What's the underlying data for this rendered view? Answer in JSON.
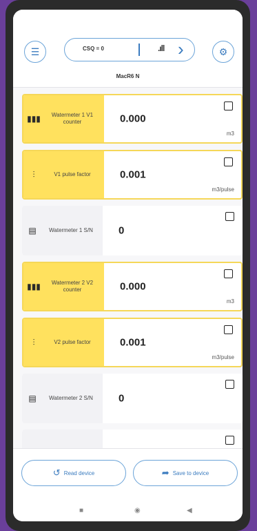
{
  "header": {
    "csq": "CSQ = 0",
    "signal": ".ıll",
    "device_name": "MacR6 N"
  },
  "rows": [
    {
      "label": "Watermeter 1 V1 counter",
      "value": "0.000",
      "unit": "m3",
      "icon": "meter-chart-icon",
      "highlight": true
    },
    {
      "label": "V1 pulse factor",
      "value": "0.001",
      "unit": "m3/pulse",
      "icon": "sliders-icon",
      "highlight": true
    },
    {
      "label": "Watermeter 1 S/N",
      "value": "0",
      "unit": "",
      "icon": "clipboard-icon",
      "highlight": false
    },
    {
      "label": "Watermeter 2 V2 counter",
      "value": "0.000",
      "unit": "m3",
      "icon": "meter-chart-icon",
      "highlight": true
    },
    {
      "label": "V2 pulse factor",
      "value": "0.001",
      "unit": "m3/pulse",
      "icon": "sliders-icon",
      "highlight": true
    },
    {
      "label": "Watermeter 2 S/N",
      "value": "0",
      "unit": "",
      "icon": "clipboard-icon",
      "highlight": false
    }
  ],
  "footer": {
    "read_label": "Read device",
    "save_label": "Save to device"
  },
  "colors": {
    "accent": "#3a7bbf",
    "highlight": "#ffe15e",
    "background": "#6a3f9a"
  }
}
